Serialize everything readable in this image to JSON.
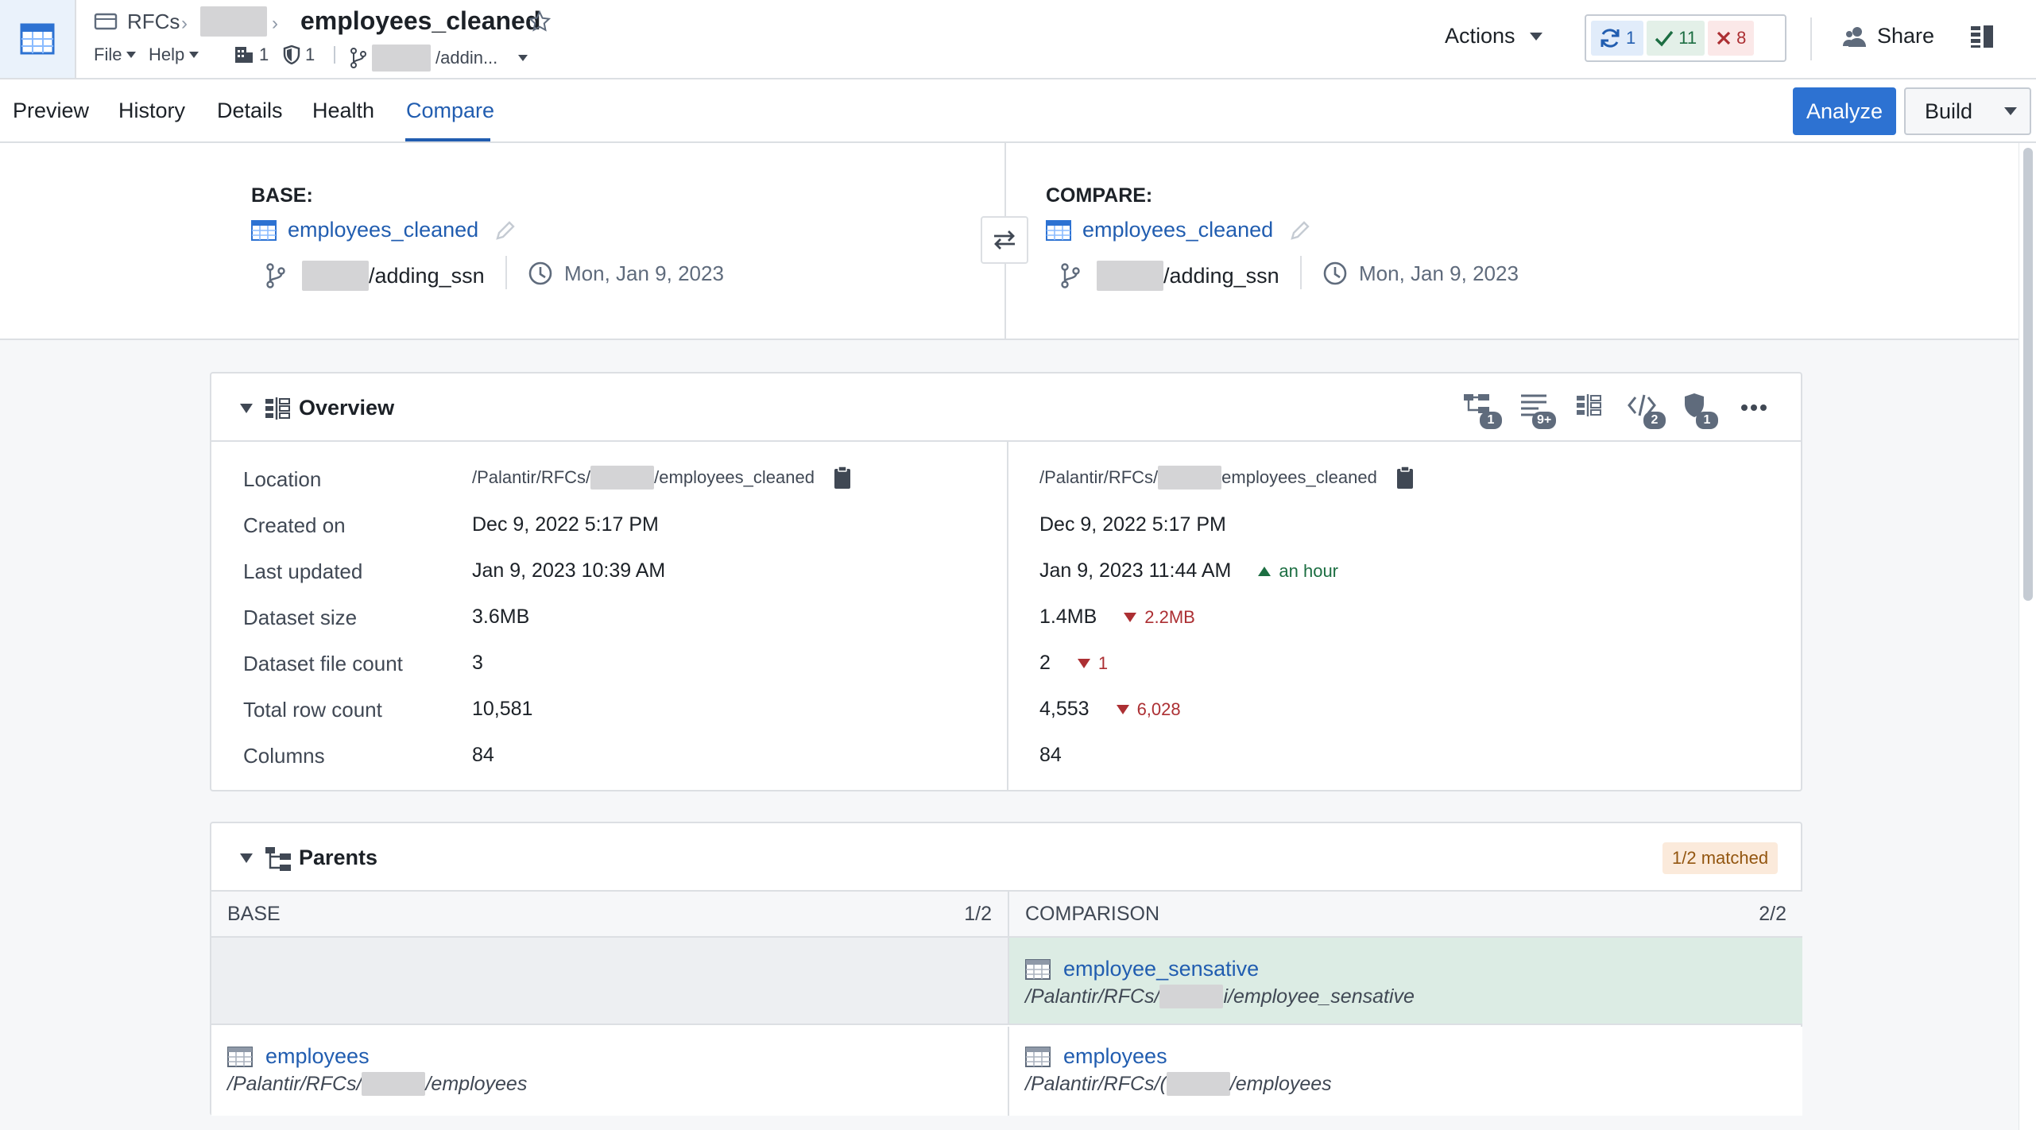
{
  "header": {
    "breadcrumb_root": "RFCs",
    "title": "employees_cleaned",
    "menu": {
      "file": "File",
      "help": "Help"
    },
    "meta": {
      "lineage_count": "1",
      "checks_count": "1",
      "branch_suffix": "/addin..."
    },
    "actions_label": "Actions",
    "status": {
      "jobs": "1",
      "passed": "11",
      "failed": "8"
    },
    "share_label": "Share"
  },
  "tabs": [
    {
      "label": "Preview"
    },
    {
      "label": "History"
    },
    {
      "label": "Details"
    },
    {
      "label": "Health"
    },
    {
      "label": "Compare"
    }
  ],
  "toolbar": {
    "analyze_label": "Analyze",
    "build_label": "Build"
  },
  "compare": {
    "base": {
      "label": "BASE:",
      "dataset": "employees_cleaned",
      "branch_suffix": "/adding_ssn",
      "date": "Mon, Jan 9, 2023"
    },
    "compare": {
      "label": "COMPARE:",
      "dataset": "employees_cleaned",
      "branch_suffix": "/adding_ssn",
      "date": "Mon, Jan 9, 2023"
    }
  },
  "overview": {
    "title": "Overview",
    "badges": {
      "parents": "1",
      "schema": "9+",
      "code": "2",
      "checks": "1"
    },
    "labels": {
      "location": "Location",
      "created_on": "Created on",
      "last_updated": "Last updated",
      "dataset_size": "Dataset size",
      "file_count": "Dataset file count",
      "row_count": "Total row count",
      "columns": "Columns"
    },
    "base": {
      "location_prefix": "/Palantir/RFCs/",
      "location_suffix": "/employees_cleaned",
      "created_on": "Dec 9, 2022 5:17 PM",
      "last_updated": "Jan 9, 2023 10:39 AM",
      "dataset_size": "3.6MB",
      "file_count": "3",
      "row_count": "10,581",
      "columns": "84"
    },
    "compare": {
      "location_prefix": "/Palantir/RFCs/",
      "location_suffix": "employees_cleaned",
      "created_on": "Dec 9, 2022 5:17 PM",
      "last_updated": "Jan 9, 2023 11:44 AM",
      "last_updated_delta": "an hour",
      "dataset_size": "1.4MB",
      "dataset_size_delta": "2.2MB",
      "file_count": "2",
      "file_count_delta": "1",
      "row_count": "4,553",
      "row_count_delta": "6,028",
      "columns": "84"
    }
  },
  "parents": {
    "title": "Parents",
    "matched": "1/2 matched",
    "base_header": "BASE",
    "base_count": "1/2",
    "compare_header": "COMPARISON",
    "compare_count": "2/2",
    "rows": [
      {
        "compare_name": "employee_sensative",
        "compare_path_prefix": "/Palantir/RFCs/",
        "compare_path_suffix": "i/employee_sensative"
      },
      {
        "base_name": "employees",
        "base_path_prefix": "/Palantir/RFCs/",
        "base_path_suffix": "/employees",
        "compare_name": "employees",
        "compare_path_prefix": "/Palantir/RFCs/(",
        "compare_path_suffix": "/employees"
      }
    ]
  },
  "colors": {
    "accent": "#2d72d2",
    "link": "#215db0",
    "success": "#1c6e42",
    "danger": "#ac2f33",
    "match_bg": "#dcece4"
  }
}
